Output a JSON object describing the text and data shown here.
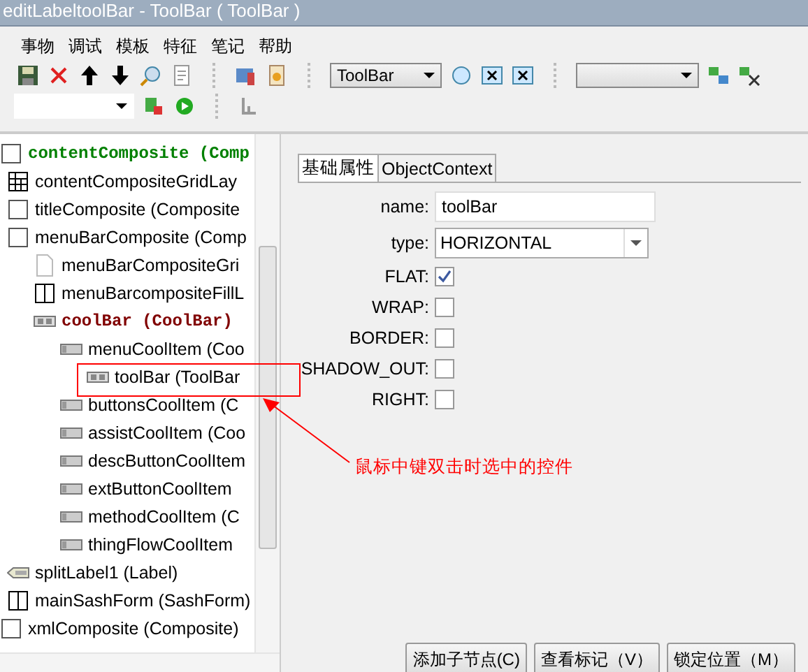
{
  "window": {
    "title": "editLabeltoolBar - ToolBar ( ToolBar )"
  },
  "menu": [
    "事物",
    "调试",
    "模板",
    "特征",
    "笔记",
    "帮助"
  ],
  "toolbar": {
    "type_combo": "ToolBar"
  },
  "tree": [
    {
      "label": "contentComposite (Comp",
      "kind": "composite",
      "color": "#008000",
      "children": [
        {
          "label": "contentCompositeGridLay",
          "kind": "grid"
        },
        {
          "label": "titleComposite (Composite",
          "kind": "composite"
        },
        {
          "label": "menuBarComposite (Comp",
          "kind": "composite",
          "children": [
            {
              "label": "menuBarCompositeGri",
              "kind": "page"
            },
            {
              "label": "menuBarcompositeFillL",
              "kind": "fill"
            },
            {
              "label": "coolBar (CoolBar)",
              "kind": "coolbar",
              "color": "#800000",
              "children": [
                {
                  "label": "menuCoolItem (Coo",
                  "kind": "coolitem",
                  "children": [
                    {
                      "label": "toolBar (ToolBar",
                      "kind": "coolbar"
                    }
                  ]
                },
                {
                  "label": "buttonsCoolItem (C",
                  "kind": "coolitem"
                },
                {
                  "label": "assistCoolItem (Coo",
                  "kind": "coolitem"
                },
                {
                  "label": "descButtonCoolItem",
                  "kind": "coolitem"
                },
                {
                  "label": "extButtonCoolItem",
                  "kind": "coolitem"
                },
                {
                  "label": "methodCoolItem (C",
                  "kind": "coolitem"
                },
                {
                  "label": "thingFlowCoolItem",
                  "kind": "coolitem"
                }
              ]
            }
          ]
        },
        {
          "label": "splitLabel1 (Label)",
          "kind": "label"
        },
        {
          "label": "mainSashForm (SashForm)",
          "kind": "fill"
        }
      ]
    },
    {
      "label": "xmlComposite (Composite)",
      "kind": "composite"
    }
  ],
  "tabs": [
    {
      "label": "基础属性",
      "selected": true
    },
    {
      "label": "ObjectContext",
      "selected": false
    }
  ],
  "fields": [
    {
      "kind": "text",
      "label": "name:",
      "value": "toolBar"
    },
    {
      "kind": "select",
      "label": "type:",
      "value": "HORIZONTAL"
    },
    {
      "kind": "checkbox",
      "label": "FLAT:",
      "checked": true
    },
    {
      "kind": "checkbox",
      "label": "WRAP:",
      "checked": false
    },
    {
      "kind": "checkbox",
      "label": "BORDER:",
      "checked": false
    },
    {
      "kind": "checkbox",
      "label": "SHADOW_OUT:",
      "checked": false
    },
    {
      "kind": "checkbox",
      "label": "RIGHT:",
      "checked": false
    }
  ],
  "annotation": {
    "text": "鼠标中键双击时选中的控件"
  },
  "buttons": [
    "添加子节点(C)",
    "查看标记（V）",
    "锁定位置（M）"
  ]
}
